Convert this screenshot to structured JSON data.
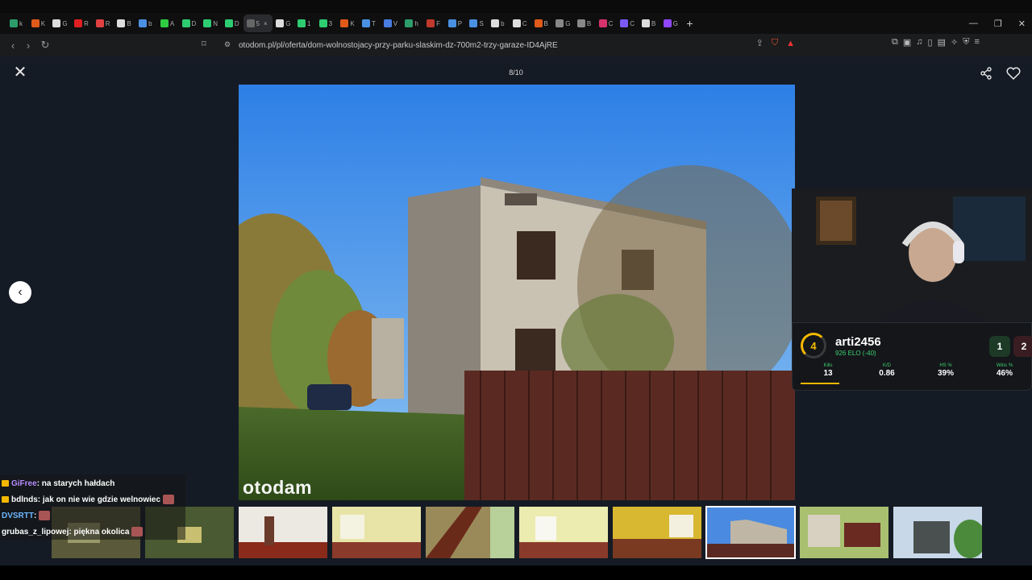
{
  "browser": {
    "tabs": [
      {
        "label": "k",
        "color": "#2d9c6a"
      },
      {
        "label": "K",
        "color": "#e05a1a"
      },
      {
        "label": "G",
        "color": "#ddd"
      },
      {
        "label": "R",
        "color": "#e02020"
      },
      {
        "label": "R",
        "color": "#e04040"
      },
      {
        "label": "B",
        "color": "#ddd"
      },
      {
        "label": "b",
        "color": "#4a90e2"
      },
      {
        "label": "A",
        "color": "#2ecc40"
      },
      {
        "label": "D",
        "color": "#2ecc71"
      },
      {
        "label": "N",
        "color": "#2ecc71"
      },
      {
        "label": "D",
        "color": "#2ecc71"
      },
      {
        "label": "5",
        "color": "#666"
      },
      {
        "label": "G",
        "color": "#ddd"
      },
      {
        "label": "1",
        "color": "#2ecc71"
      },
      {
        "label": "3",
        "color": "#2ecc71"
      },
      {
        "label": "K",
        "color": "#e05a1a"
      },
      {
        "label": "T",
        "color": "#4a90e2"
      },
      {
        "label": "V",
        "color": "#4a7de2"
      },
      {
        "label": "h",
        "color": "#2d9c6a"
      },
      {
        "label": "F",
        "color": "#c0392b"
      },
      {
        "label": "P",
        "color": "#4a90e2"
      },
      {
        "label": "S",
        "color": "#4a90e2"
      },
      {
        "label": "b",
        "color": "#ddd"
      },
      {
        "label": "C",
        "color": "#ddd"
      },
      {
        "label": "B",
        "color": "#e05a1a"
      },
      {
        "label": "G",
        "color": "#888"
      },
      {
        "label": "B",
        "color": "#888"
      },
      {
        "label": "C",
        "color": "#d6336c"
      },
      {
        "label": "C",
        "color": "#7a5af5"
      },
      {
        "label": "B",
        "color": "#ddd"
      },
      {
        "label": "G",
        "color": "#9146ff"
      }
    ],
    "active_tab_index": 11,
    "active_tab_label": "5",
    "url": "otodom.pl/pl/oferta/dom-wolnostojacy-przy-parku-slaskim-dz-700m2-trzy-garaze-ID4AjRE"
  },
  "gallery": {
    "counter": "8/10",
    "watermark": "otodam",
    "current_index": 8,
    "total": 10
  },
  "stream_overlay": {
    "level": "4",
    "username": "arti2456",
    "elo": "926 ELO (-40)",
    "wins_badge": "1",
    "losses_badge": "2",
    "stats": [
      {
        "label": "Kills",
        "value": "13"
      },
      {
        "label": "K/D",
        "value": "0.86"
      },
      {
        "label": "HS %",
        "value": "39%"
      },
      {
        "label": "Wins %",
        "value": "46%"
      }
    ]
  },
  "chat": [
    {
      "user": "GiFree",
      "user_color": "#b78cff",
      "message": " : na starych hałdach",
      "badge": true,
      "emote": false
    },
    {
      "user": "bdlnds",
      "user_color": "#ffffff",
      "message": " : jak on nie wie gdzie welnowiec",
      "badge": true,
      "emote": true
    },
    {
      "user": "DVSRTT",
      "user_color": "#6db7ff",
      "message": " :",
      "badge": false,
      "emote": true
    },
    {
      "user": "grubas_z_lipowej",
      "user_color": "#ffffff",
      "message": " : piękna okolica",
      "badge": false,
      "emote": true
    }
  ]
}
